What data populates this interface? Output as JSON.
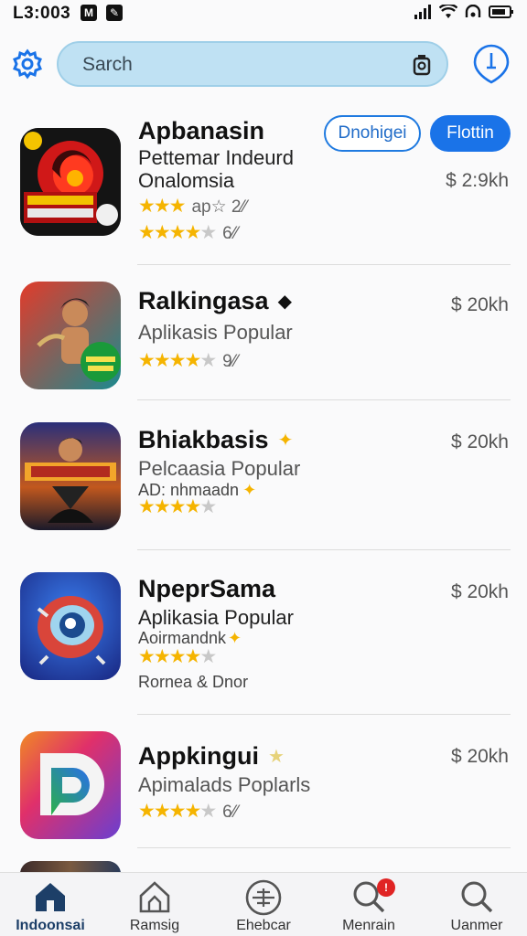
{
  "status": {
    "time": "L3:003",
    "icons": [
      "m-icon",
      "note-icon",
      "signal-icon",
      "wifi-icon",
      "sync-icon",
      "battery-icon"
    ]
  },
  "search": {
    "placeholder": "Sarch"
  },
  "colors": {
    "accent": "#1a73e8",
    "search_bg": "#bfe1f3",
    "star": "#f5b400",
    "nav_active": "#1d3f68"
  },
  "apps": [
    {
      "name": "Apbanasin",
      "subtitle": "Pettemar Indeurd",
      "category": "Onalomsia",
      "price": "$ 2:9kh",
      "rating1_text": "ap☆  2⁄⁄",
      "rating2_text": "6⁄⁄",
      "button_outline": "Dnohigei",
      "button_fill": "Flottin",
      "icon": "red-swirl-game-icon"
    },
    {
      "name": "Ralkingasa",
      "subtitle": "Aplikasis Popular",
      "price": "$ 20kh",
      "rating_text": "9⁄⁄",
      "icon": "warrior-game-icon"
    },
    {
      "name": "Bhiakbasis",
      "subtitle": "Pelcaasia Popular",
      "small": "AD: nhmaadn",
      "price": "$ 20kh",
      "icon": "fighter-game-icon"
    },
    {
      "name": "NpeprSama",
      "subtitle": "Aplikasia Popular",
      "small": "Aoirmandnk",
      "footer": "Rornea & Dnor",
      "price": "$ 20kh",
      "icon": "eye-creature-icon"
    },
    {
      "name": "Appkingui",
      "subtitle": "Apimalads Poplarls",
      "price": "$ 20kh",
      "rating_text": "6⁄⁄",
      "icon": "gradient-d-logo-icon"
    }
  ],
  "nav": [
    {
      "label": "Indoonsai",
      "icon": "home-icon",
      "active": true
    },
    {
      "label": "Ramsig",
      "icon": "house-outline-icon",
      "active": false
    },
    {
      "label": "Ehebcar",
      "icon": "compass-icon",
      "active": false
    },
    {
      "label": "Menrain",
      "icon": "search-badge-icon",
      "active": false,
      "badge": "!"
    },
    {
      "label": "Uanmer",
      "icon": "search-icon",
      "active": false
    }
  ]
}
